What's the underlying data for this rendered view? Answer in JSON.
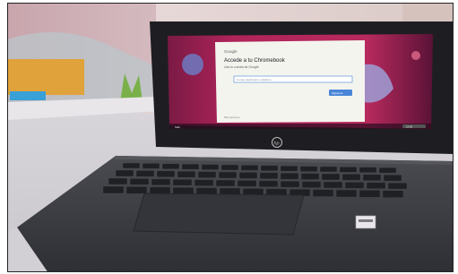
{
  "photo": {
    "subject": "HP Chromebook laptop on a white desk showing the Chrome OS sign-in screen",
    "brand_logo": "hp"
  },
  "signin_card": {
    "brand": "Google",
    "title": "Accede a tu Chromebook",
    "subtitle": "Usa tu cuenta de Google",
    "email_placeholder": "Correo electrónico o teléfono",
    "next_button": "Siguiente",
    "more_options": "Más opciones"
  },
  "shelf": {
    "left_label": "Salir",
    "status_label": "12:00"
  },
  "colors": {
    "wallpaper_magenta": "#b0245a",
    "wallpaper_dark": "#3a1030",
    "card_bg": "#f4f4ee",
    "accent_blue": "#4a86d8",
    "laptop_body": "#3c3d42"
  }
}
